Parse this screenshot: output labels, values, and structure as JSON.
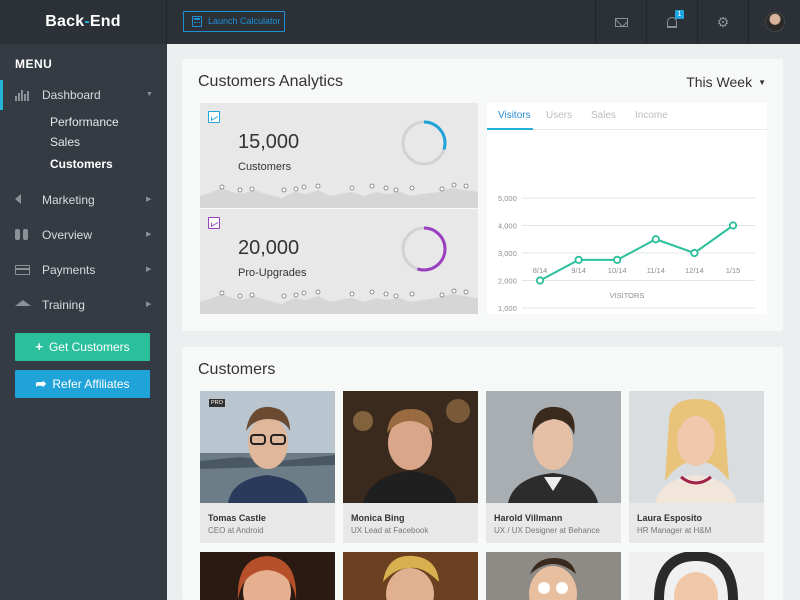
{
  "brand": {
    "part1": "Back",
    "dash": "-",
    "part2": "End"
  },
  "header": {
    "launch_label": "Launch Calculator",
    "notification_count": "1"
  },
  "sidebar": {
    "menu_title": "MENU",
    "items": [
      {
        "label": "Dashboard",
        "icon": "bar-chart-icon"
      },
      {
        "label": "Marketing",
        "icon": "megaphone-icon"
      },
      {
        "label": "Overview",
        "icon": "binoculars-icon"
      },
      {
        "label": "Payments",
        "icon": "credit-card-icon"
      },
      {
        "label": "Training",
        "icon": "graduation-cap-icon"
      }
    ],
    "dashboard_sub": [
      "Performance",
      "Sales",
      "Customers"
    ],
    "get_customers": "Get Customers",
    "refer_affiliates": "Refer Affiliates"
  },
  "analytics": {
    "title": "Customers Analytics",
    "period": "This Week",
    "stats": [
      {
        "value": "15,000",
        "label": "Customers",
        "color": "#1fa3d9",
        "progress": 0.3
      },
      {
        "value": "20,000",
        "label": "Pro-Upgrades",
        "color": "#9b3fc1",
        "progress": 0.55
      }
    ],
    "tabs": [
      "Visitors",
      "Users",
      "Sales",
      "Income"
    ]
  },
  "chart_data": {
    "type": "line",
    "categories": [
      "8/14",
      "9/14",
      "10/14",
      "11/14",
      "12/14",
      "1/15"
    ],
    "values": [
      2000,
      2750,
      2750,
      3500,
      3000,
      4000
    ],
    "y_ticks": [
      "5,000",
      "4,000",
      "3,000",
      "2,000",
      "1,000"
    ],
    "ylim": [
      1000,
      5000
    ],
    "xlabel": "VISITORS",
    "color": "#2bc09b",
    "grid": true
  },
  "customers": {
    "title": "Customers",
    "people": [
      {
        "name": "Tomas Castle",
        "role": "CEO at Android",
        "badge": "PRO"
      },
      {
        "name": "Monica Bing",
        "role": "UX Lead at Facebook"
      },
      {
        "name": "Harold Villmann",
        "role": "UX / UX Designer at Behance"
      },
      {
        "name": "Laura Esposito",
        "role": "HR Manager at H&M"
      }
    ]
  }
}
